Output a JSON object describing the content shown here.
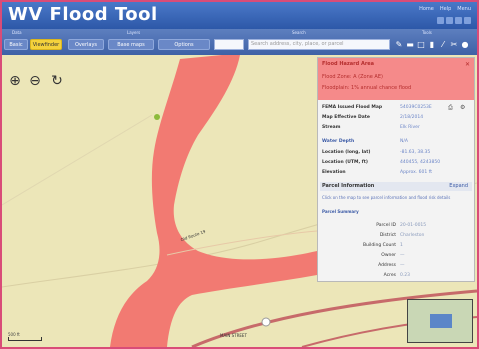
{
  "header": {
    "title": "WV Flood Tool",
    "links": [
      "Home",
      "Help",
      "Menu"
    ]
  },
  "toolbar": {
    "groups": [
      "Data",
      "Layers",
      "Search",
      "Tools"
    ],
    "buttons": [
      "Basic",
      "Overlays",
      "Base maps",
      "Options"
    ],
    "yellow_button": "Viewfinder",
    "search_placeholder": "Search address, city, place, or parcel"
  },
  "map": {
    "road_label": "Old Route 19",
    "bottom_label": "MAIN STREET",
    "scale_label": "500 ft"
  },
  "panel": {
    "title": "Flood Hazard Area",
    "line2": "Flood Zone: A (Zone AE)",
    "line3": "Floodplain: 1% annual chance flood",
    "rows": [
      {
        "k": "FEMA Issued Flood Map",
        "v": "54039C0253E"
      },
      {
        "k": "Map Effective Date",
        "v": "2/18/2014"
      },
      {
        "k": "Stream",
        "v": "Elk River"
      },
      {
        "k": "Water Depth",
        "v": "N/A"
      },
      {
        "k": "Location (long, lat)",
        "v": "-81.63, 38.35"
      },
      {
        "k": "Location (UTM, ft)",
        "v": "440455, 4243850"
      },
      {
        "k": "Elevation",
        "v": "Approx. 601 ft"
      }
    ],
    "section_title": "Parcel Information",
    "section_more": "Expand",
    "note": "Click on the map to see parcel information and flood risk details",
    "note_title": "Parcel Summary",
    "kv": [
      {
        "k": "Parcel ID",
        "v": "20-01-0015"
      },
      {
        "k": "District",
        "v": "Charleston"
      },
      {
        "k": "Building Count",
        "v": "1"
      },
      {
        "k": "Owner",
        "v": "—"
      },
      {
        "k": "Address",
        "v": "—"
      },
      {
        "k": "Acres",
        "v": "0.23"
      }
    ]
  },
  "colors": {
    "flood": "#f27a72",
    "land": "#ece6b8",
    "header": "#3a64b4"
  }
}
